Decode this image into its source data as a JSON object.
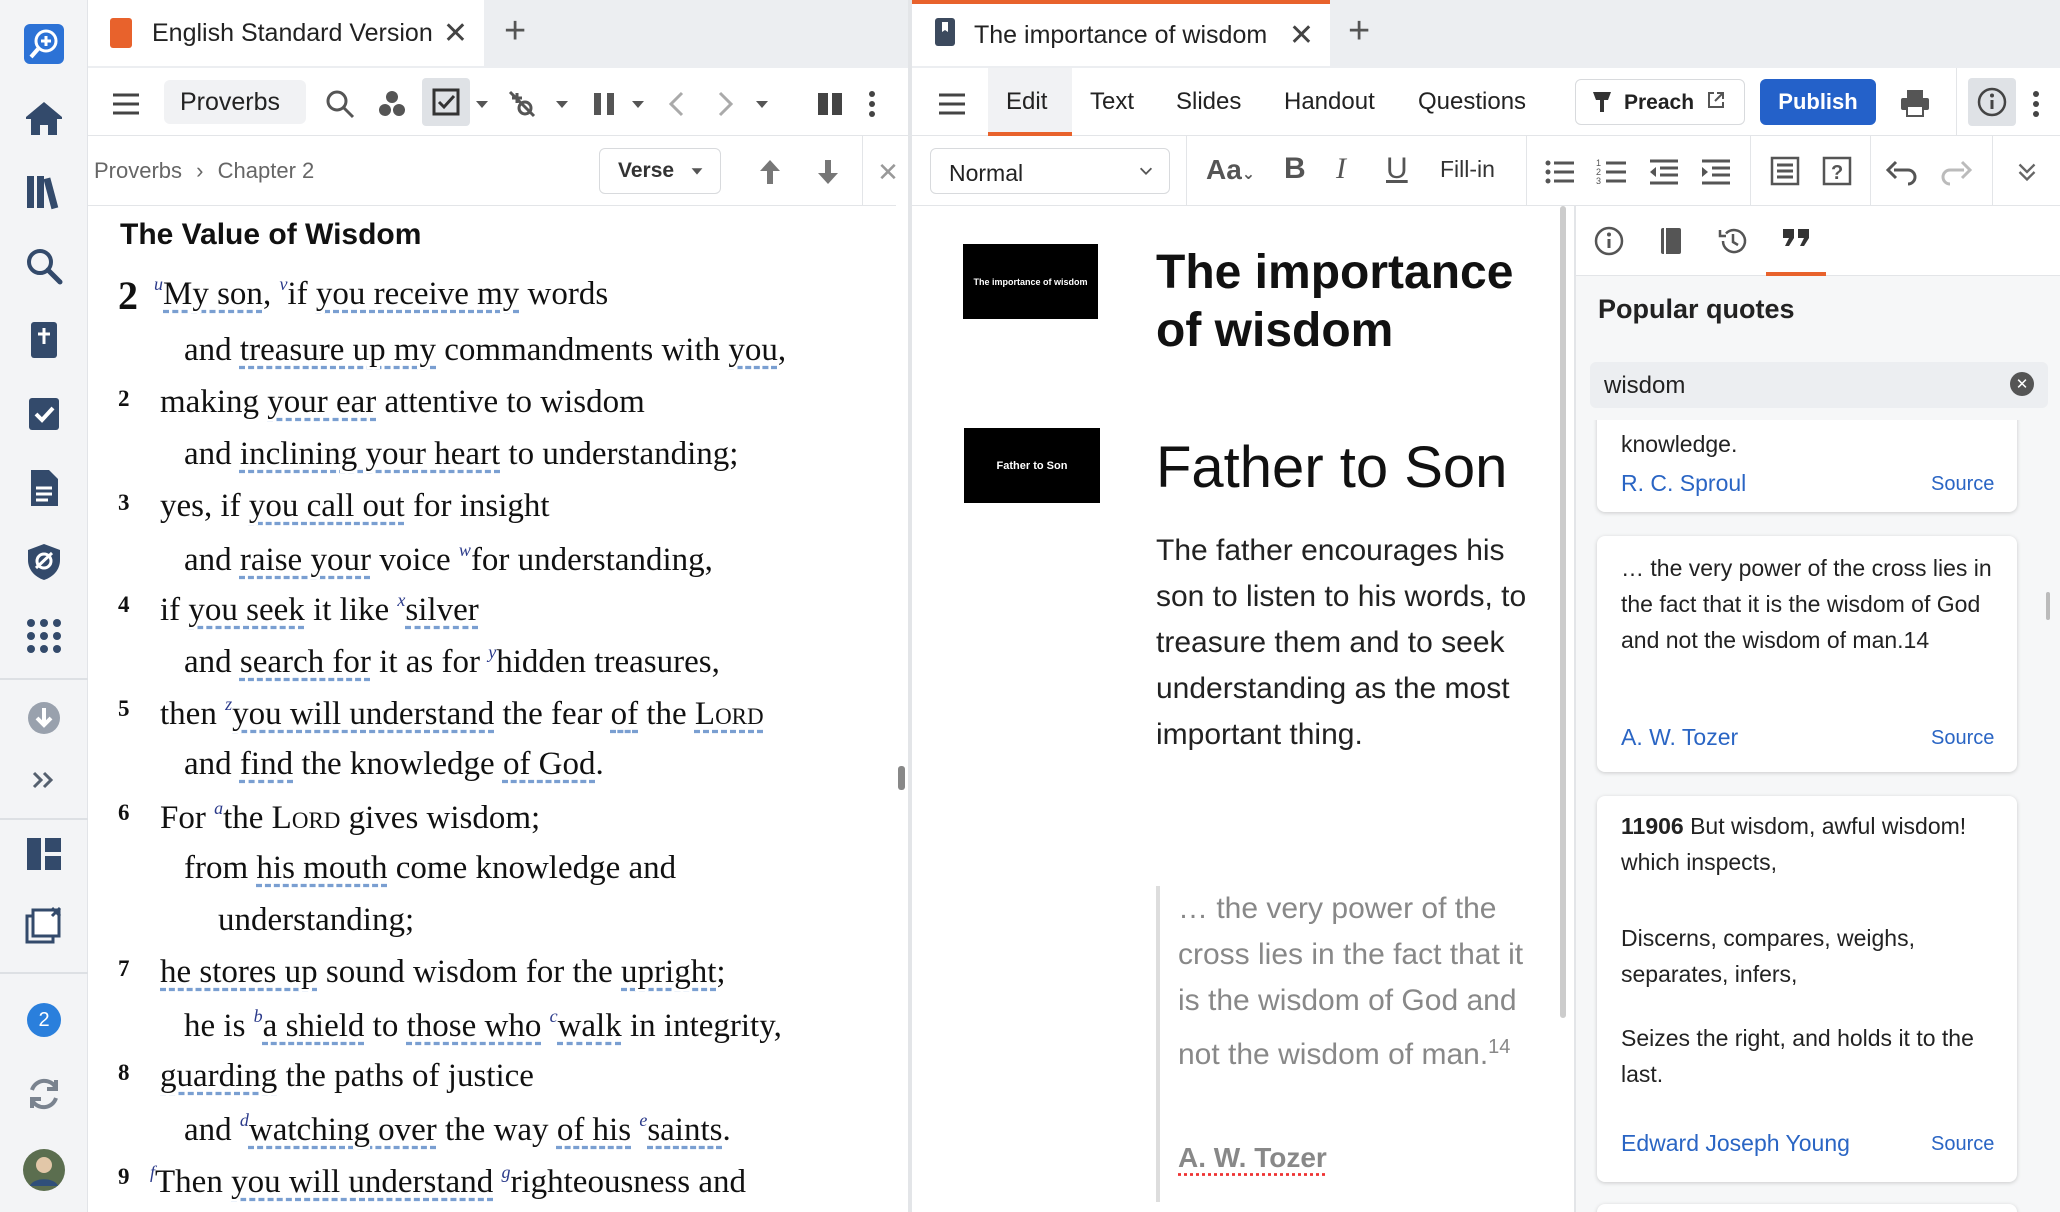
{
  "left_tab": {
    "title": "English Standard Version"
  },
  "right_tab": {
    "title": "The importance of wisdom"
  },
  "bible_toolbar": {
    "book": "Proverbs"
  },
  "breadcrumb": {
    "book": "Proverbs",
    "chapter": "Chapter 2",
    "mode": "Verse"
  },
  "bible": {
    "heading": "The Value of Wisdom",
    "chapter": "2",
    "lines": [
      {
        "v": "",
        "text": "My son, if you receive my words"
      },
      {
        "v": "",
        "text": "and treasure up my commandments with you,"
      },
      {
        "v": "2",
        "text": "making your ear attentive to wisdom"
      },
      {
        "v": "",
        "text": "and inclining your heart to understanding;"
      },
      {
        "v": "3",
        "text": "yes, if you call out for insight"
      },
      {
        "v": "",
        "text": "and raise your voice for understanding,"
      },
      {
        "v": "4",
        "text": "if you seek it like silver"
      },
      {
        "v": "",
        "text": "and search for it as for hidden treasures,"
      },
      {
        "v": "5",
        "text": "then you will understand the fear of the Lord"
      },
      {
        "v": "",
        "text": "and find the knowledge of God."
      },
      {
        "v": "6",
        "text": "For the Lord gives wisdom;"
      },
      {
        "v": "",
        "text": "from his mouth come knowledge and"
      },
      {
        "v": "",
        "text": "understanding;"
      },
      {
        "v": "7",
        "text": "he stores up sound wisdom for the upright;"
      },
      {
        "v": "",
        "text": "he is a shield to those who walk in integrity,"
      },
      {
        "v": "8",
        "text": "guarding the paths of justice"
      },
      {
        "v": "",
        "text": "and watching over the way of his saints."
      },
      {
        "v": "9",
        "text": "Then you will understand righteousness and"
      }
    ]
  },
  "editor_toolbar": {
    "tabs": [
      "Edit",
      "Text",
      "Slides",
      "Handout",
      "Questions"
    ],
    "preach": "Preach",
    "publish": "Publish",
    "style": "Normal",
    "fill_in": "Fill-in"
  },
  "document": {
    "slide1_thumb": "The importance of wisdom",
    "title": "The importance of wisdom",
    "slide2_thumb": "Father to Son",
    "subtitle": "Father to Son",
    "body": "The father encourages his son to listen to his words, to treasure them and to seek understanding as the most important thing.",
    "quote": "… the very power of the cross lies in the fact that it is the wisdom of God and not the wisdom of man.",
    "quote_footnote": "14",
    "quote_author": "A. W. Tozer"
  },
  "quotes_panel": {
    "title": "Popular quotes",
    "search_value": "wisdom",
    "cards": [
      {
        "text": "knowledge.",
        "author": "R. C. Sproul",
        "source": "Source"
      },
      {
        "text": "… the very power of the cross lies in the fact that it is the wisdom of God and not the wisdom of man.14",
        "author": "A. W. Tozer",
        "source": "Source"
      },
      {
        "id": "11906",
        "text": "But wisdom, awful wisdom! which inspects,",
        "text2": "Discerns, compares, weighs, separates, infers,",
        "text3": "Seizes the right, and holds it to the last.",
        "author": "Edward Joseph Young",
        "source": "Source"
      }
    ]
  },
  "rail": {
    "badge": "2"
  },
  "colors": {
    "accent": "#e8622c",
    "link": "#2a65c4",
    "publish": "#2461c9"
  }
}
